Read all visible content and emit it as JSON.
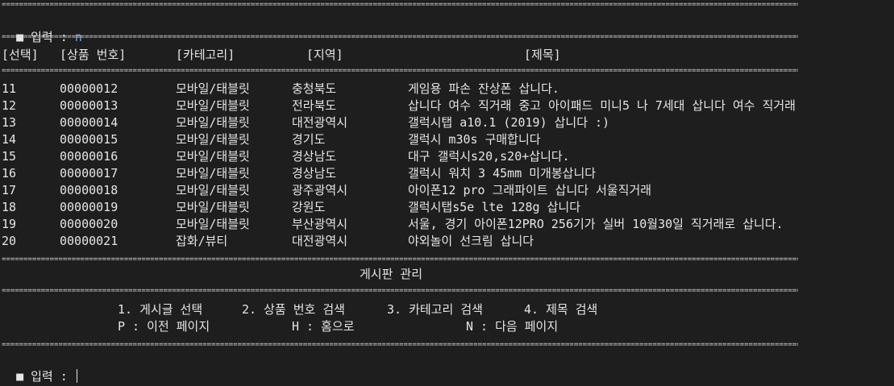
{
  "top_prompt": {
    "label": "■ 입력 : ",
    "value": "n"
  },
  "headers": [
    "[선택]",
    "[상품 번호]",
    "[카테고리]",
    "[지역]",
    "[제목]"
  ],
  "rows": [
    {
      "sel": "11",
      "num": "00000012",
      "cat": "모바일/태블릿",
      "region": "충청북도",
      "title": "게임용 파손 잔상폰 삽니다."
    },
    {
      "sel": "12",
      "num": "00000013",
      "cat": "모바일/태블릿",
      "region": "전라북도",
      "title": "삽니다 여수 직거래 중고 아이패드 미니5 나 7세대 삽니다 여수 직거래"
    },
    {
      "sel": "13",
      "num": "00000014",
      "cat": "모바일/태블릿",
      "region": "대전광역시",
      "title": "갤럭시탭 a10.1 (2019) 삽니다 :)"
    },
    {
      "sel": "14",
      "num": "00000015",
      "cat": "모바일/태블릿",
      "region": "경기도",
      "title": "갤럭시 m30s 구매합니다"
    },
    {
      "sel": "15",
      "num": "00000016",
      "cat": "모바일/태블릿",
      "region": "경상남도",
      "title": "대구 갤럭시s20,s20+삽니다."
    },
    {
      "sel": "16",
      "num": "00000017",
      "cat": "모바일/태블릿",
      "region": "경상남도",
      "title": "갤럭시 워치 3 45mm 미개봉삽니다"
    },
    {
      "sel": "17",
      "num": "00000018",
      "cat": "모바일/태블릿",
      "region": "광주광역시",
      "title": "아이폰12 pro 그래파이트 삽니다 서울직거래"
    },
    {
      "sel": "18",
      "num": "00000019",
      "cat": "모바일/태블릿",
      "region": "강원도",
      "title": "갤럭시탭s5e lte 128g 삽니다"
    },
    {
      "sel": "19",
      "num": "00000020",
      "cat": "모바일/태블릿",
      "region": "부산광역시",
      "title": "서울, 경기 아이폰12PRO 256기가 실버 10월30일 직거래로 삽니다."
    },
    {
      "sel": "20",
      "num": "00000021",
      "cat": "잡화/뷰티",
      "region": "대전광역시",
      "title": "야외놀이 선크림 삽니다"
    }
  ],
  "board_title": "게시판 관리",
  "menu": {
    "opt1": "1. 게시글 선택",
    "opt2": "2. 상품 번호 검색",
    "opt3": "3. 카테고리 검색",
    "opt4": "4. 제목 검색",
    "prev": "P : 이전 페이지",
    "home": "H : 홈으로",
    "next": "N : 다음 페이지"
  },
  "bottom_prompt": {
    "label": "■ 입력 : ",
    "value": ""
  }
}
